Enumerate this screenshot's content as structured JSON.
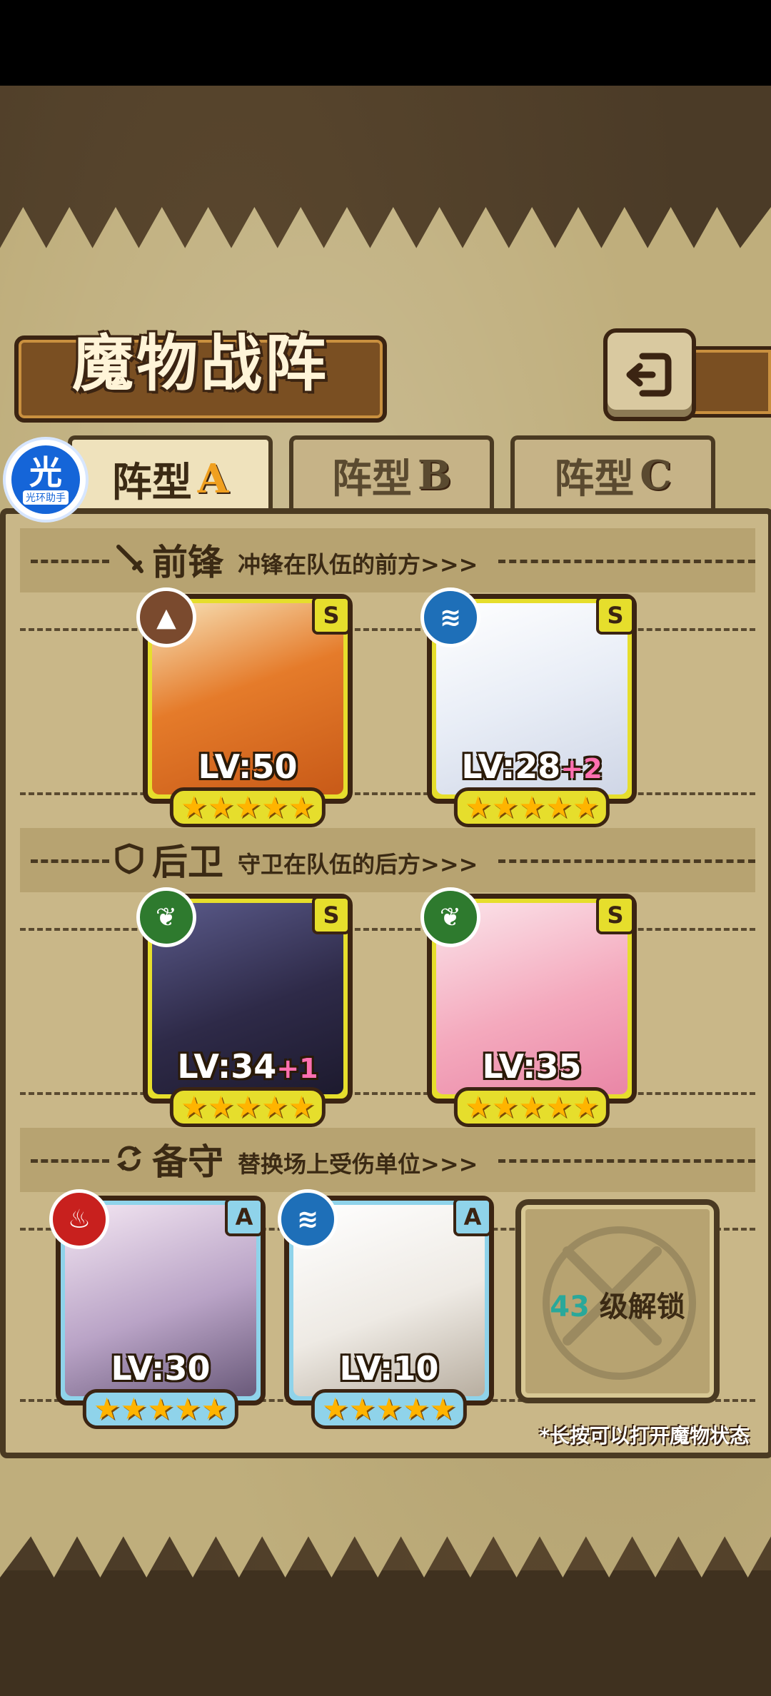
{
  "title": "魔物战阵",
  "tabs": [
    {
      "prefix": "阵型",
      "letter": "A",
      "active": true
    },
    {
      "prefix": "阵型",
      "letter": "B",
      "active": false
    },
    {
      "prefix": "阵型",
      "letter": "C",
      "active": false
    }
  ],
  "sections": {
    "front": {
      "title": "前锋",
      "subtitle": "冲锋在队伍的前方>>>",
      "icon": "sword-icon"
    },
    "back": {
      "title": "后卫",
      "subtitle": "守卫在队伍的后方>>>",
      "icon": "shield-icon"
    },
    "reserve": {
      "title": "备守",
      "subtitle": "替换场上受伤单位>>>",
      "icon": "swap-icon"
    }
  },
  "cards": {
    "front1": {
      "level": "LV:50",
      "plus": "",
      "rank": "S",
      "element": "earth-icon",
      "stars": "★★★★★"
    },
    "front2": {
      "level": "LV:28",
      "plus": "+2",
      "rank": "S",
      "element": "water-icon",
      "stars": "★★★★★"
    },
    "back1": {
      "level": "LV:34",
      "plus": "+1",
      "rank": "S",
      "element": "leaf-icon",
      "stars": "★★★★★"
    },
    "back2": {
      "level": "LV:35",
      "plus": "",
      "rank": "S",
      "element": "leaf-icon",
      "stars": "★★★★★"
    },
    "res1": {
      "level": "LV:30",
      "plus": "",
      "rank": "A",
      "element": "fire-icon",
      "stars": "★★★★★"
    },
    "res2": {
      "level": "LV:10",
      "plus": "",
      "rank": "A",
      "element": "water-icon",
      "stars": "★★★★★"
    }
  },
  "locked": {
    "level": "43",
    "label": "级解锁"
  },
  "hint": "*长按可以打开魔物状态",
  "helper": {
    "glyph": "光",
    "label": "光环助手"
  },
  "colors": {
    "s_frame": "#e6de2c",
    "a_frame": "#8fd3ea",
    "plus": "#ff6fb0",
    "lock_num": "#2aa89a"
  }
}
